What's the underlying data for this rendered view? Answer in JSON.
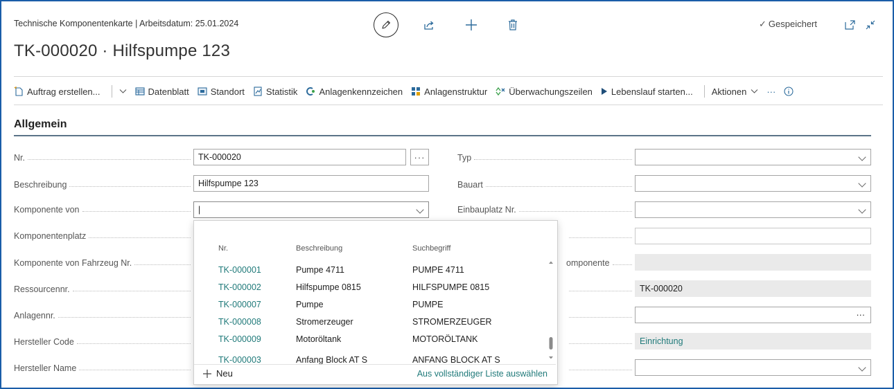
{
  "header": {
    "subtitle": "Technische Komponentenkarte | Arbeitsdatum: 25.01.2024",
    "title": "TK-000020 · Hilfspumpe 123",
    "saved_status": "Gespeichert"
  },
  "toolbar": {
    "items": [
      {
        "label": "Auftrag erstellen...",
        "icon": "new-document-icon"
      },
      {
        "label": "Datenblatt",
        "icon": "datasheet-icon"
      },
      {
        "label": "Standort",
        "icon": "location-icon"
      },
      {
        "label": "Statistik",
        "icon": "chart-icon"
      },
      {
        "label": "Anlagenkennzeichen",
        "icon": "tag-icon"
      },
      {
        "label": "Anlagenstruktur",
        "icon": "structure-icon"
      },
      {
        "label": "Überwachungszeilen",
        "icon": "monitoring-icon"
      },
      {
        "label": "Lebenslauf starten...",
        "icon": "play-icon"
      }
    ],
    "actions_label": "Aktionen",
    "more_label": "···"
  },
  "section": {
    "title": "Allgemein"
  },
  "left_fields": [
    {
      "label": "Nr.",
      "value": "TK-000020"
    },
    {
      "label": "Beschreibung",
      "value": "Hilfspumpe 123"
    },
    {
      "label": "Komponente von",
      "value": "|"
    },
    {
      "label": "Komponentenplatz",
      "value": ""
    },
    {
      "label": "Komponente von Fahrzeug Nr.",
      "value": ""
    },
    {
      "label": "Ressourcennr.",
      "value": ""
    },
    {
      "label": "Anlagennr.",
      "value": ""
    },
    {
      "label": "Hersteller Code",
      "value": ""
    },
    {
      "label": "Hersteller Name",
      "value": ""
    }
  ],
  "right_fields": [
    {
      "label": "Typ",
      "value": ""
    },
    {
      "label": "Bauart",
      "value": ""
    },
    {
      "label": "Einbauplatz Nr.",
      "value": ""
    },
    {
      "label": "",
      "value": ""
    },
    {
      "label": "omponente",
      "value": ""
    },
    {
      "label": "",
      "value": "TK-000020"
    },
    {
      "label": "",
      "value": "···"
    },
    {
      "label": "",
      "value": "Einrichtung"
    },
    {
      "label": "",
      "value": ""
    }
  ],
  "lookup": {
    "columns": [
      "Nr.",
      "Beschreibung",
      "Suchbegriff"
    ],
    "rows": [
      {
        "no": "TK-000001",
        "desc": "Pumpe 4711",
        "key": "PUMPE 4711"
      },
      {
        "no": "TK-000002",
        "desc": "Hilfspumpe 0815",
        "key": "HILFSPUMPE 0815"
      },
      {
        "no": "TK-000007",
        "desc": "Pumpe",
        "key": "PUMPE"
      },
      {
        "no": "TK-000008",
        "desc": "Stromerzeuger",
        "key": "STROMERZEUGER"
      },
      {
        "no": "TK-000009",
        "desc": "Motoröltank",
        "key": "MOTORÖLTANK"
      },
      {
        "no": "TK-000003",
        "desc": "Anfang Block AT S",
        "key": "ANFANG BLOCK AT S"
      }
    ],
    "new_label": "Neu",
    "full_list_label": "Aus vollständiger Liste auswählen"
  },
  "colors": {
    "accent": "#207a7a",
    "frame": "#1a5da8",
    "icon": "#2b6a9b"
  }
}
